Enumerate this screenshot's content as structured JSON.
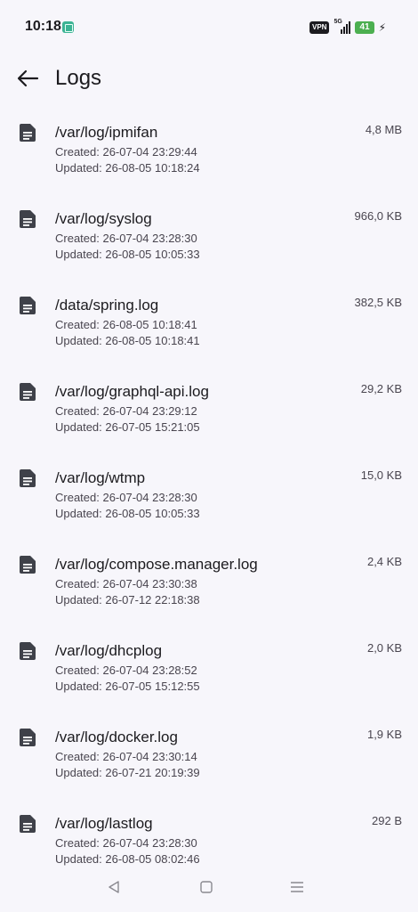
{
  "status_bar": {
    "time": "10:18",
    "vpn": "VPN",
    "network": "5G",
    "battery": "41"
  },
  "header": {
    "title": "Logs"
  },
  "logs": [
    {
      "name": "/var/log/ipmifan",
      "created": "Created: 26-07-04 23:29:44",
      "updated": "Updated: 26-08-05 10:18:24",
      "size": "4,8 MB"
    },
    {
      "name": "/var/log/syslog",
      "created": "Created: 26-07-04 23:28:30",
      "updated": "Updated: 26-08-05 10:05:33",
      "size": "966,0 KB"
    },
    {
      "name": "/data/spring.log",
      "created": "Created: 26-08-05 10:18:41",
      "updated": "Updated: 26-08-05 10:18:41",
      "size": "382,5 KB"
    },
    {
      "name": "/var/log/graphql-api.log",
      "created": "Created: 26-07-04 23:29:12",
      "updated": "Updated: 26-07-05 15:21:05",
      "size": "29,2 KB"
    },
    {
      "name": "/var/log/wtmp",
      "created": "Created: 26-07-04 23:28:30",
      "updated": "Updated: 26-08-05 10:05:33",
      "size": "15,0 KB"
    },
    {
      "name": "/var/log/compose.manager.log",
      "created": "Created: 26-07-04 23:30:38",
      "updated": "Updated: 26-07-12 22:18:38",
      "size": "2,4 KB"
    },
    {
      "name": "/var/log/dhcplog",
      "created": "Created: 26-07-04 23:28:52",
      "updated": "Updated: 26-07-05 15:12:55",
      "size": "2,0 KB"
    },
    {
      "name": "/var/log/docker.log",
      "created": "Created: 26-07-04 23:30:14",
      "updated": "Updated: 26-07-21 20:19:39",
      "size": "1,9 KB"
    },
    {
      "name": "/var/log/lastlog",
      "created": "Created: 26-07-04 23:28:30",
      "updated": "Updated: 26-08-05 08:02:46",
      "size": "292 B"
    }
  ],
  "icons": {
    "back": "arrow-back-icon",
    "log_item": "description-icon",
    "nav_back": "triangle-back-icon",
    "nav_home": "square-home-icon",
    "nav_recents": "menu-lines-icon"
  },
  "colors": {
    "background": "#f7f6fb",
    "text_primary": "#1c1b1f",
    "text_secondary": "#49454f",
    "icon": "#3f4149",
    "battery": "#4caf50"
  }
}
